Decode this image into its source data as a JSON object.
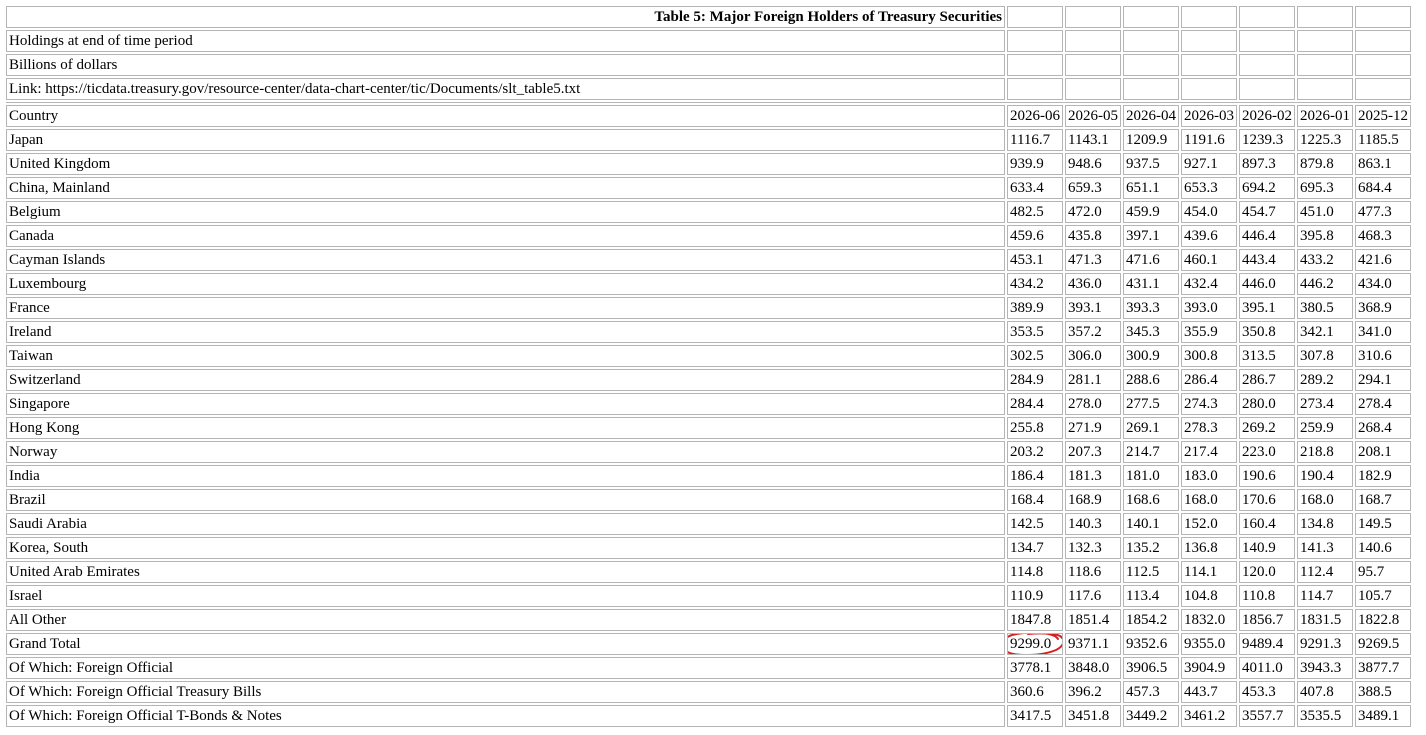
{
  "title": "Table 5: Major Foreign Holders of Treasury Securities",
  "subtitles": [
    "Holdings at end of time period",
    "Billions of dollars",
    "Link: https://ticdata.treasury.gov/resource-center/data-chart-center/tic/Documents/slt_table5.txt"
  ],
  "header": {
    "country": "Country",
    "periods": [
      "2026-06",
      "2026-05",
      "2026-04",
      "2026-03",
      "2026-02",
      "2026-01",
      "2025-12"
    ]
  },
  "rows": [
    {
      "country": "Japan",
      "values": [
        "1116.7",
        "1143.1",
        "1209.9",
        "1191.6",
        "1239.3",
        "1225.3",
        "1185.5"
      ]
    },
    {
      "country": "United Kingdom",
      "values": [
        "939.9",
        "948.6",
        "937.5",
        "927.1",
        "897.3",
        "879.8",
        "863.1"
      ]
    },
    {
      "country": "China, Mainland",
      "values": [
        "633.4",
        "659.3",
        "651.1",
        "653.3",
        "694.2",
        "695.3",
        "684.4"
      ]
    },
    {
      "country": "Belgium",
      "values": [
        "482.5",
        "472.0",
        "459.9",
        "454.0",
        "454.7",
        "451.0",
        "477.3"
      ]
    },
    {
      "country": "Canada",
      "values": [
        "459.6",
        "435.8",
        "397.1",
        "439.6",
        "446.4",
        "395.8",
        "468.3"
      ]
    },
    {
      "country": "Cayman Islands",
      "values": [
        "453.1",
        "471.3",
        "471.6",
        "460.1",
        "443.4",
        "433.2",
        "421.6"
      ]
    },
    {
      "country": "Luxembourg",
      "values": [
        "434.2",
        "436.0",
        "431.1",
        "432.4",
        "446.0",
        "446.2",
        "434.0"
      ]
    },
    {
      "country": "France",
      "values": [
        "389.9",
        "393.1",
        "393.3",
        "393.0",
        "395.1",
        "380.5",
        "368.9"
      ]
    },
    {
      "country": "Ireland",
      "values": [
        "353.5",
        "357.2",
        "345.3",
        "355.9",
        "350.8",
        "342.1",
        "341.0"
      ]
    },
    {
      "country": "Taiwan",
      "values": [
        "302.5",
        "306.0",
        "300.9",
        "300.8",
        "313.5",
        "307.8",
        "310.6"
      ]
    },
    {
      "country": "Switzerland",
      "values": [
        "284.9",
        "281.1",
        "288.6",
        "286.4",
        "286.7",
        "289.2",
        "294.1"
      ]
    },
    {
      "country": "Singapore",
      "values": [
        "284.4",
        "278.0",
        "277.5",
        "274.3",
        "280.0",
        "273.4",
        "278.4"
      ]
    },
    {
      "country": "Hong Kong",
      "values": [
        "255.8",
        "271.9",
        "269.1",
        "278.3",
        "269.2",
        "259.9",
        "268.4"
      ]
    },
    {
      "country": "Norway",
      "values": [
        "203.2",
        "207.3",
        "214.7",
        "217.4",
        "223.0",
        "218.8",
        "208.1"
      ]
    },
    {
      "country": "India",
      "values": [
        "186.4",
        "181.3",
        "181.0",
        "183.0",
        "190.6",
        "190.4",
        "182.9"
      ]
    },
    {
      "country": "Brazil",
      "values": [
        "168.4",
        "168.9",
        "168.6",
        "168.0",
        "170.6",
        "168.0",
        "168.7"
      ]
    },
    {
      "country": "Saudi Arabia",
      "values": [
        "142.5",
        "140.3",
        "140.1",
        "152.0",
        "160.4",
        "134.8",
        "149.5"
      ]
    },
    {
      "country": "Korea, South",
      "values": [
        "134.7",
        "132.3",
        "135.2",
        "136.8",
        "140.9",
        "141.3",
        "140.6"
      ]
    },
    {
      "country": "United Arab Emirates",
      "values": [
        "114.8",
        "118.6",
        "112.5",
        "114.1",
        "120.0",
        "112.4",
        "95.7"
      ]
    },
    {
      "country": "Israel",
      "values": [
        "110.9",
        "117.6",
        "113.4",
        "104.8",
        "110.8",
        "114.7",
        "105.7"
      ]
    },
    {
      "country": "All Other",
      "values": [
        "1847.8",
        "1851.4",
        "1854.2",
        "1832.0",
        "1856.7",
        "1831.5",
        "1822.8"
      ]
    },
    {
      "country": "Grand Total",
      "values": [
        "9299.0",
        "9371.1",
        "9352.6",
        "9355.0",
        "9489.4",
        "9291.3",
        "9269.5"
      ]
    },
    {
      "country": "Of Which: Foreign Official",
      "values": [
        "3778.1",
        "3848.0",
        "3906.5",
        "3904.9",
        "4011.0",
        "3943.3",
        "3877.7"
      ]
    },
    {
      "country": "Of Which: Foreign Official Treasury Bills",
      "values": [
        "360.6",
        "396.2",
        "457.3",
        "443.7",
        "453.3",
        "407.8",
        "388.5"
      ]
    },
    {
      "country": "Of Which: Foreign Official T-Bonds & Notes",
      "values": [
        "3417.5",
        "3451.8",
        "3449.2",
        "3461.2",
        "3557.7",
        "3535.5",
        "3489.1"
      ]
    }
  ],
  "annotation": {
    "type": "hand-drawn circle",
    "color": "#d42020",
    "row_index": 21,
    "col_index": 0
  }
}
